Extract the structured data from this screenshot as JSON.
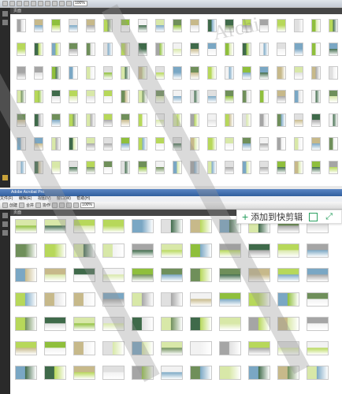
{
  "top_window": {
    "app_title": "",
    "toolbar": {
      "zoom_value": "100%"
    },
    "panel_title": "页面",
    "watermark_text": "Archi"
  },
  "bottom_window": {
    "app_title": "Adobe Acrobat Pro",
    "menus": [
      "文件(F)",
      "编辑(E)",
      "视图(V)",
      "窗口(W)",
      "帮助(H)"
    ],
    "toolbar": {
      "create_label": "创建",
      "combine_label": "合并",
      "collab_label": "协作",
      "zoom_value": "100%"
    },
    "panel_title": "页面"
  },
  "clip_overlay": {
    "add_label": "添加到快剪辑"
  },
  "colors": {
    "accent_green": "#2aa060",
    "leftbar_bg": "#2a2a2a",
    "panel_bg": "#454545"
  }
}
